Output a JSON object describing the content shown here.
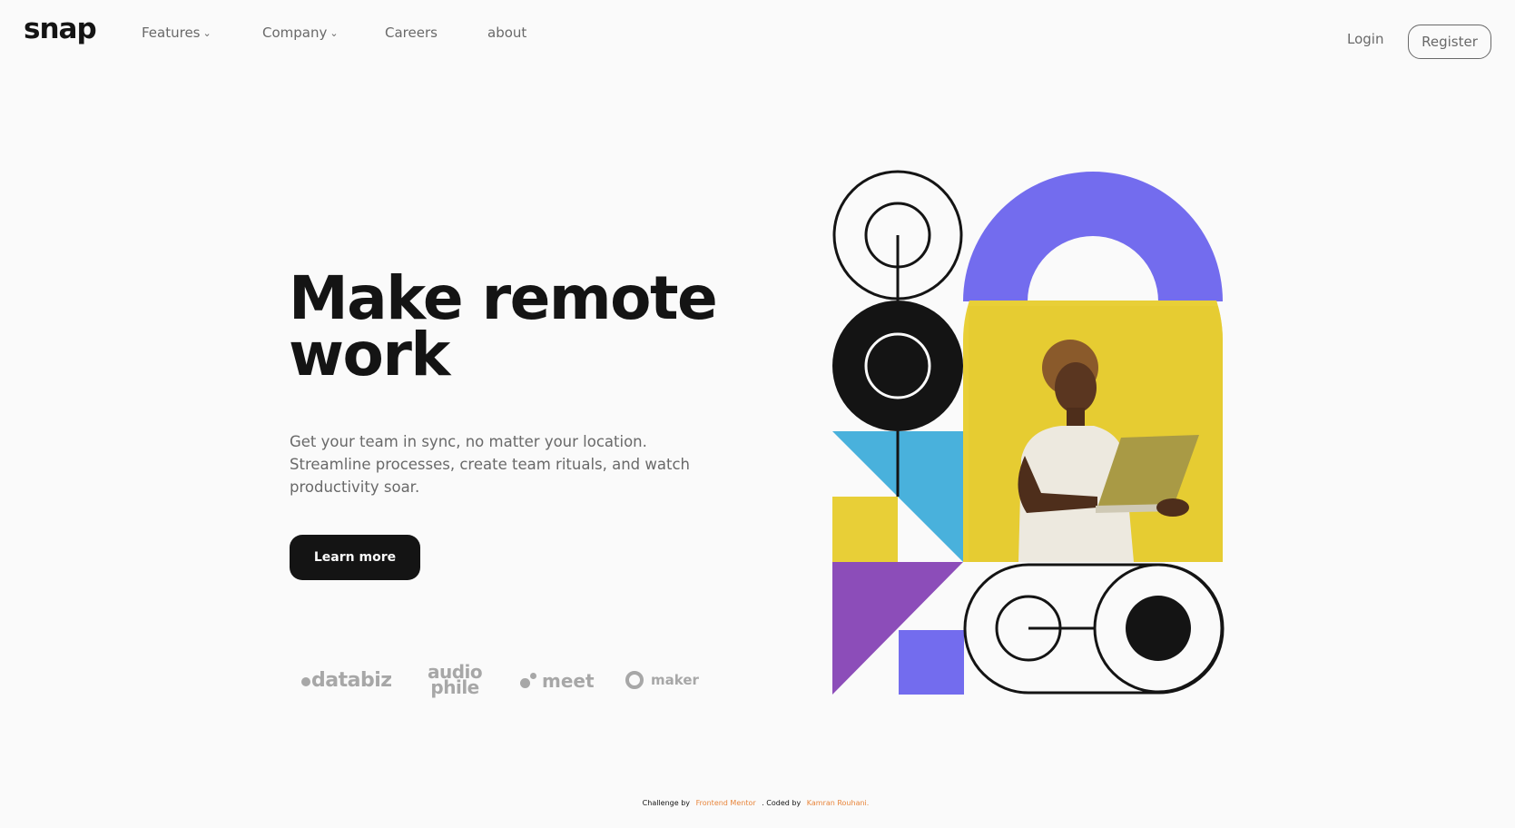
{
  "brand": {
    "logo": "snap"
  },
  "nav": {
    "items": [
      {
        "label": "Features",
        "has_dropdown": true
      },
      {
        "label": "Company",
        "has_dropdown": true
      },
      {
        "label": "Careers",
        "has_dropdown": false
      },
      {
        "label": "about",
        "has_dropdown": false
      }
    ],
    "dropdown_glyph": "⌄",
    "login": "Login",
    "register": "Register"
  },
  "hero": {
    "title_line1": "Make remote",
    "title_line2": "work",
    "description": "Get your team in sync, no matter your location. Streamline processes, create team rituals, and watch productivity soar.",
    "cta": "Learn more"
  },
  "clients": {
    "databiz": "databiz",
    "audiophile_top": "audio",
    "audiophile_bottom": "phile",
    "meet": "meet",
    "maker": "maker"
  },
  "footer": {
    "prefix": "Challenge by",
    "challenge_link": "Frontend Mentor",
    "middle": ". Coded by",
    "author_link": "Kamran Rouhani."
  },
  "colors": {
    "ink": "#141414",
    "muted": "#696969",
    "background": "#fafafa",
    "purple_arch": "#736cee",
    "yellow": "#e8cf37",
    "sky": "#49b1dc",
    "violet": "#8c4db9",
    "footer_link": "#e8853b"
  }
}
